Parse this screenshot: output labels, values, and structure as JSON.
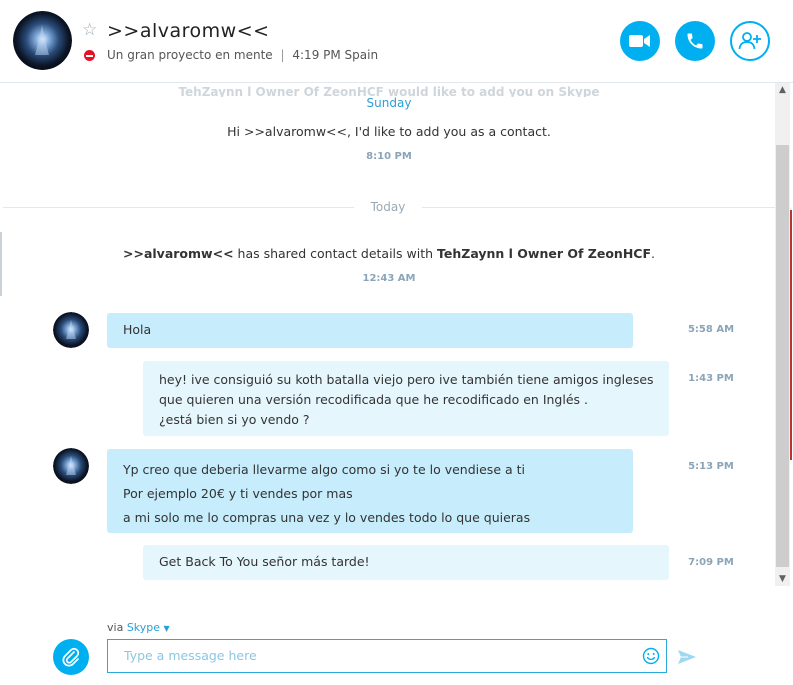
{
  "header": {
    "contact_name": ">>alvaromw<<",
    "mood": "Un gran proyecto en mente",
    "separator": "|",
    "local_time": "4:19 PM Spain"
  },
  "chat": {
    "faded_text": "TehZaynn l Owner Of ZeonHCF would like to add you on Skype",
    "day_sunday": "Sunday",
    "request_text": "Hi >>alvaromw<<, I'd like to add you as a contact.",
    "request_time": "8:10 PM",
    "day_today": "Today",
    "shared_sender": ">>alvaromw<<",
    "shared_middle": " has shared contact details with ",
    "shared_target": "TehZaynn l Owner Of ZeonHCF",
    "shared_end": ".",
    "shared_time": "12:43 AM",
    "messages": [
      {
        "direction": "in",
        "lines": [
          "Hola"
        ],
        "time": "5:58 AM"
      },
      {
        "direction": "out",
        "lines": [
          "hey! ive consiguió su koth batalla viejo pero ive también tiene amigos ingleses",
          "que quieren una versión recodificada que he recodificado en Inglés .",
          "¿está bien si yo vendo ?"
        ],
        "time": "1:43 PM"
      },
      {
        "direction": "in",
        "lines": [
          "Yp creo que deberia llevarme algo como si yo te lo vendiese a ti",
          "Por ejemplo 20€ y ti vendes por mas",
          "a mi solo me lo compras una vez y lo vendes todo lo que quieras"
        ],
        "time": "5:13 PM"
      },
      {
        "direction": "out",
        "lines": [
          "Get Back To You señor más tarde!"
        ],
        "time": "7:09 PM"
      }
    ]
  },
  "compose": {
    "via_label": "via",
    "service": "Skype",
    "placeholder": "Type a message here"
  },
  "colors": {
    "accent": "#00aff0",
    "incoming_bubble": "#c7edfc",
    "outgoing_bubble": "#e6f6fd",
    "status_busy": "#e81123"
  },
  "icons": [
    "star-icon",
    "busy-status-icon",
    "video-call-icon",
    "phone-icon",
    "add-contact-icon",
    "attach-icon",
    "emoji-icon",
    "send-icon",
    "scroll-up-icon",
    "scroll-down-icon"
  ]
}
